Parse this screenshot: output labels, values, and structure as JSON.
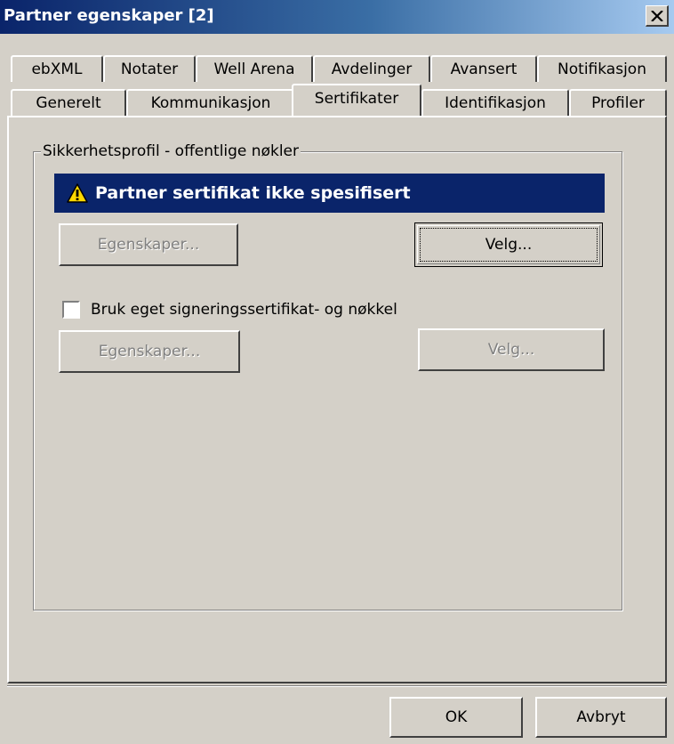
{
  "window": {
    "title": "Partner egenskaper [2]",
    "close_glyph": "×"
  },
  "tabs": {
    "row1": [
      "ebXML",
      "Notater",
      "Well Arena",
      "Avdelinger",
      "Avansert",
      "Notifikasjon"
    ],
    "row2": [
      "Generelt",
      "Kommunikasjon",
      "Sertifikater",
      "Identifikasjon",
      "Profiler"
    ],
    "active": "Sertifikater"
  },
  "group": {
    "legend": "Sikkerhetsprofil - offentlige nøkler",
    "banner_text": "Partner sertifikat ikke spesifisert",
    "banner_icon": "warning-icon",
    "properties_label_1": "Egenskaper...",
    "select_label_1": "Velg...",
    "checkbox_label": "Bruk eget signeringssertifikat- og nøkkel",
    "checkbox_checked": false,
    "properties_label_2": "Egenskaper...",
    "select_label_2": "Velg..."
  },
  "footer": {
    "ok_label": "OK",
    "cancel_label": "Avbryt"
  },
  "colors": {
    "window_bg": "#d4d0c8",
    "titlebar_start": "#0a246a",
    "titlebar_end": "#a6caf0",
    "banner_bg": "#0a246a",
    "warning_yellow": "#ffd800"
  }
}
